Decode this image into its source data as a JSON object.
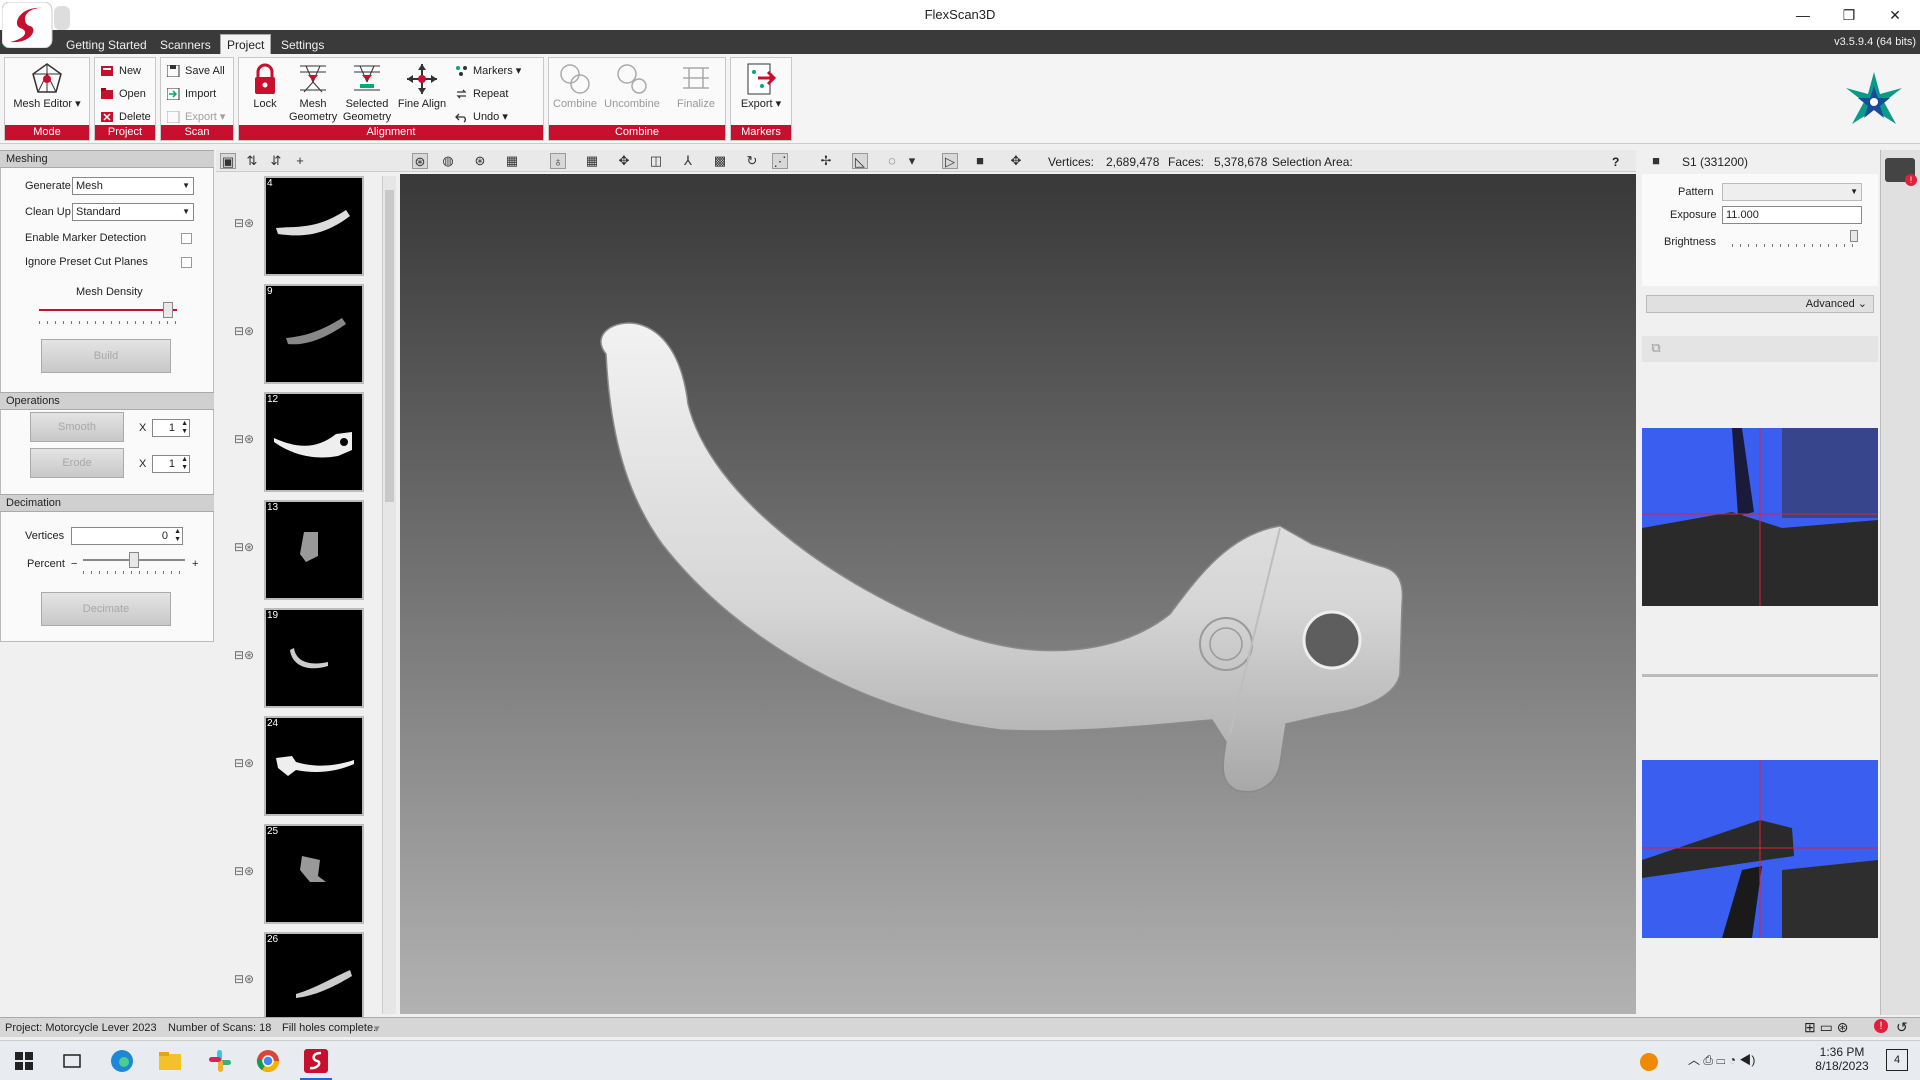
{
  "window": {
    "title": "FlexScan3D",
    "minimize": "—",
    "restore": "❐",
    "close": "✕"
  },
  "menu": {
    "tabs": [
      "Getting Started",
      "Scanners",
      "Project",
      "Settings"
    ],
    "version": "v3.5.9.4  (64 bits)"
  },
  "ribbon": {
    "mode": {
      "label": "Mode",
      "mesh_editor": "Mesh Editor"
    },
    "project": {
      "label": "Project",
      "new": "New",
      "open": "Open",
      "delete": "Delete"
    },
    "scan": {
      "label": "Scan",
      "save_all": "Save All",
      "import": "Import",
      "export": "Export"
    },
    "alignment": {
      "label": "Alignment",
      "lock": "Lock",
      "mesh_geometry": "Mesh Geometry",
      "selected_geometry": "Selected Geometry",
      "fine_align": "Fine Align",
      "markers": "Markers",
      "repeat": "Repeat",
      "undo": "Undo"
    },
    "combine": {
      "label": "Combine",
      "combine": "Combine",
      "uncombine": "Uncombine",
      "finalize": "Finalize"
    },
    "markers": {
      "label": "Markers",
      "export": "Export"
    }
  },
  "meshing": {
    "title": "Meshing",
    "generate_label": "Generate",
    "generate_value": "Mesh",
    "cleanup_label": "Clean Up",
    "cleanup_value": "Standard",
    "enable_marker": "Enable Marker Detection",
    "ignore_preset": "Ignore Preset Cut Planes",
    "mesh_density": "Mesh Density",
    "mesh_density_level": 0.97,
    "build": "Build"
  },
  "operations": {
    "title": "Operations",
    "smooth": "Smooth",
    "smooth_x": "1",
    "erode": "Erode",
    "erode_x": "1",
    "x": "X"
  },
  "decimation": {
    "title": "Decimation",
    "vertices_label": "Vertices",
    "vertices_value": "0",
    "percent_label": "Percent",
    "minus": "−",
    "plus": "+",
    "percent_level": 0.5,
    "decimate": "Decimate"
  },
  "scans": [
    {
      "num": "4"
    },
    {
      "num": "9"
    },
    {
      "num": "12"
    },
    {
      "num": "13"
    },
    {
      "num": "19"
    },
    {
      "num": "24"
    },
    {
      "num": "25"
    },
    {
      "num": "26"
    }
  ],
  "viewbar": {
    "vertices_label": "Vertices:",
    "vertices_value": "2,689,478",
    "faces_label": "Faces:",
    "faces_value": "5,378,678",
    "selection_label": "Selection Area:",
    "help": "?"
  },
  "camera": {
    "title": "S1 (331200)",
    "pattern_label": "Pattern",
    "exposure_label": "Exposure",
    "exposure_value": "11.000",
    "brightness_label": "Brightness",
    "advanced": "Advanced"
  },
  "status": {
    "project": "Project:  Motorcycle Lever 2023",
    "scans": "Number of Scans:  18",
    "message": "Fill holes complete."
  },
  "taskbar": {
    "time": "1:36 PM",
    "date": "8/18/2023",
    "notifications": "4"
  },
  "colors": {
    "accent": "#c8102e",
    "camera_blue": "#3a5ef0"
  }
}
